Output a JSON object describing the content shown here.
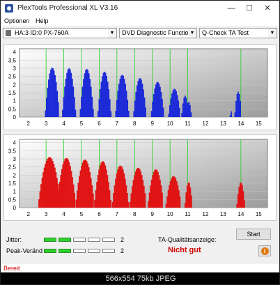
{
  "window": {
    "title": "PlexTools Professional XL V3.16"
  },
  "menu": {
    "items": [
      "Optionen",
      "Help"
    ]
  },
  "toolbar": {
    "drive": "HA:3 ID:0  PX-760A",
    "function": "DVD Diagnostic Functions",
    "test": "Q-Check TA Test"
  },
  "chart_data": [
    {
      "type": "bar",
      "title": "",
      "x_ticks": [
        2,
        3,
        4,
        5,
        6,
        7,
        8,
        9,
        10,
        11,
        12,
        13,
        14,
        15
      ],
      "y_ticks": [
        4,
        3.5,
        3,
        2.5,
        2,
        1.5,
        1,
        0.5,
        0
      ],
      "xlim": [
        1.5,
        15.5
      ],
      "ylim": [
        0,
        4.2
      ],
      "color": "#1c2ad8",
      "green_lines": [
        3,
        4,
        5,
        6,
        7,
        8,
        9,
        10,
        11,
        14
      ],
      "groups": [
        {
          "center": 3.35,
          "halfwidth": 0.38,
          "peak": 3.1
        },
        {
          "center": 4.3,
          "halfwidth": 0.36,
          "peak": 3.0
        },
        {
          "center": 5.3,
          "halfwidth": 0.36,
          "peak": 2.9
        },
        {
          "center": 6.3,
          "halfwidth": 0.36,
          "peak": 2.85
        },
        {
          "center": 7.3,
          "halfwidth": 0.36,
          "peak": 2.6
        },
        {
          "center": 8.3,
          "halfwidth": 0.34,
          "peak": 2.4
        },
        {
          "center": 9.3,
          "halfwidth": 0.34,
          "peak": 2.1
        },
        {
          "center": 10.25,
          "halfwidth": 0.32,
          "peak": 1.8
        },
        {
          "center": 10.85,
          "halfwidth": 0.18,
          "peak": 1.25
        },
        {
          "center": 11.05,
          "halfwidth": 0.16,
          "peak": 1.0
        },
        {
          "center": 13.85,
          "halfwidth": 0.18,
          "peak": 1.5
        },
        {
          "center": 13.45,
          "halfwidth": 0.05,
          "peak": 0.3
        }
      ]
    },
    {
      "type": "bar",
      "title": "",
      "x_ticks": [
        2,
        3,
        4,
        5,
        6,
        7,
        8,
        9,
        10,
        11,
        12,
        13,
        14,
        15
      ],
      "y_ticks": [
        4,
        3.5,
        3,
        2.5,
        2,
        1.5,
        1,
        0.5,
        0
      ],
      "xlim": [
        1.5,
        15.5
      ],
      "ylim": [
        0,
        4.2
      ],
      "color": "#e01414",
      "green_lines": [
        3,
        4,
        5,
        6,
        7,
        8,
        9,
        10,
        11,
        14
      ],
      "groups": [
        {
          "center": 3.2,
          "halfwidth": 0.6,
          "peak": 3.05
        },
        {
          "center": 4.15,
          "halfwidth": 0.5,
          "peak": 3.0
        },
        {
          "center": 5.2,
          "halfwidth": 0.5,
          "peak": 2.9
        },
        {
          "center": 6.2,
          "halfwidth": 0.45,
          "peak": 2.8
        },
        {
          "center": 7.2,
          "halfwidth": 0.45,
          "peak": 2.65
        },
        {
          "center": 8.2,
          "halfwidth": 0.45,
          "peak": 2.45
        },
        {
          "center": 9.2,
          "halfwidth": 0.42,
          "peak": 2.3
        },
        {
          "center": 10.2,
          "halfwidth": 0.42,
          "peak": 2.0
        },
        {
          "center": 11.05,
          "halfwidth": 0.2,
          "peak": 1.5
        },
        {
          "center": 14.0,
          "halfwidth": 0.22,
          "peak": 1.55
        }
      ]
    }
  ],
  "quality": {
    "jitter_label": "Jitter:",
    "jitter_value": "2",
    "jitter_level": 2,
    "peak_label": "Peak-Veränd",
    "peak_value": "2",
    "peak_level": 2,
    "segments_total": 5,
    "ta_label": "TA-Qualitätsanzeige:",
    "ta_result": "Nicht gut",
    "ta_result_color": "#d20000"
  },
  "buttons": {
    "start": "Start",
    "info": "i"
  },
  "status": {
    "text": "Bereit"
  },
  "caption": "566x554  75kb  JPEG"
}
